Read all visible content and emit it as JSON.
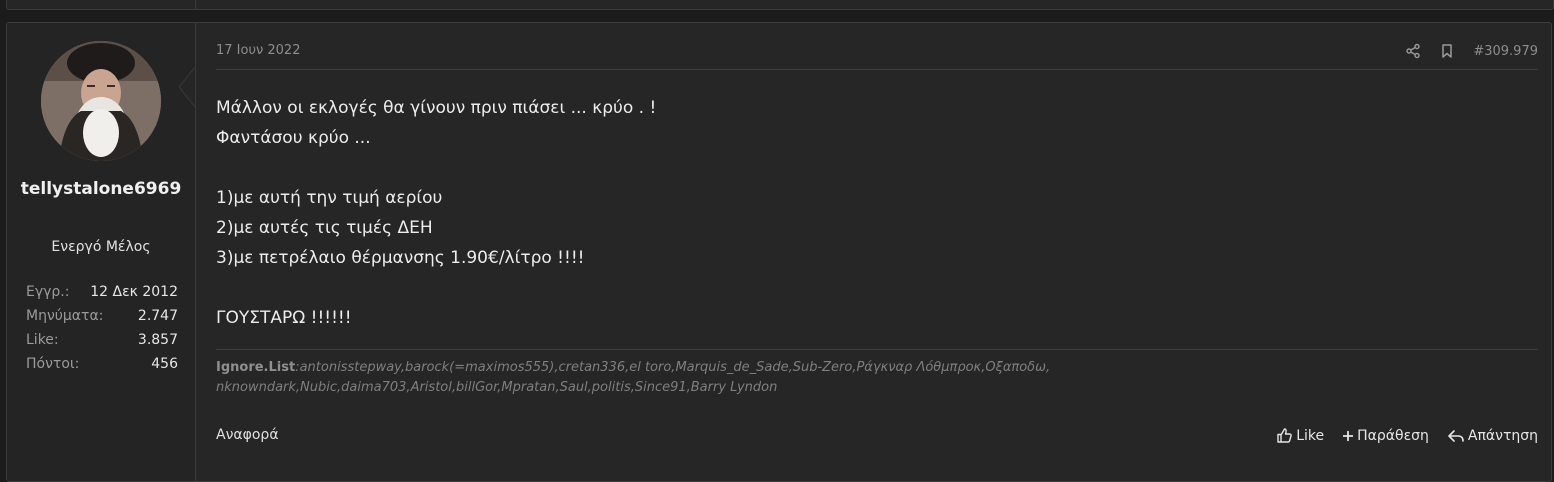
{
  "post": {
    "date": "17 Ιουν 2022",
    "number": "#309.979",
    "body_lines": [
      "Μάλλον οι εκλογές θα γίνουν πριν πιάσει ... κρύο . !",
      "Φαντάσου κρύο ...",
      "",
      "1)με αυτή την τιμή αερίου",
      "2)με αυτές τις τιμές ΔΕΗ",
      "3)με πετρέλαιο θέρμανσης 1.90€/λίτρο !!!!",
      "",
      "ΓΟΥΣΤΑΡΩ !!!!!!"
    ]
  },
  "user": {
    "name": "tellystalone6969",
    "title": "Ενεργό Μέλος",
    "stats": [
      {
        "label": "Εγγρ.:",
        "value": "12 Δεκ 2012"
      },
      {
        "label": "Μηνύματα:",
        "value": "2.747"
      },
      {
        "label": "Like:",
        "value": "3.857"
      },
      {
        "label": "Πόντοι:",
        "value": "456"
      }
    ]
  },
  "signature": {
    "label": "Ignore.List",
    "list": ":antonisstepway,barock(=maximos555),cretan336,el toro,Marquis_de_Sade,Sub-Zero,Ράγκναρ Λόθμπροκ,Οξαποδω,",
    "list_line2": "nknowndark,Nubic,daima703,Aristol,billGor,Mpratan,Saul,politis,Since91,Barry Lyndon"
  },
  "footer": {
    "report": "Αναφορά",
    "like": "Like",
    "quote": "Παράθεση",
    "reply": "Απάντηση"
  },
  "icons": [
    "share-icon",
    "bookmark-icon",
    "thumbs-up-icon",
    "plus-icon",
    "reply-icon"
  ],
  "colors": {
    "background": "#1c1c1c",
    "panel": "#262626",
    "text": "#e8e8e8",
    "muted": "#8d8d8d"
  }
}
